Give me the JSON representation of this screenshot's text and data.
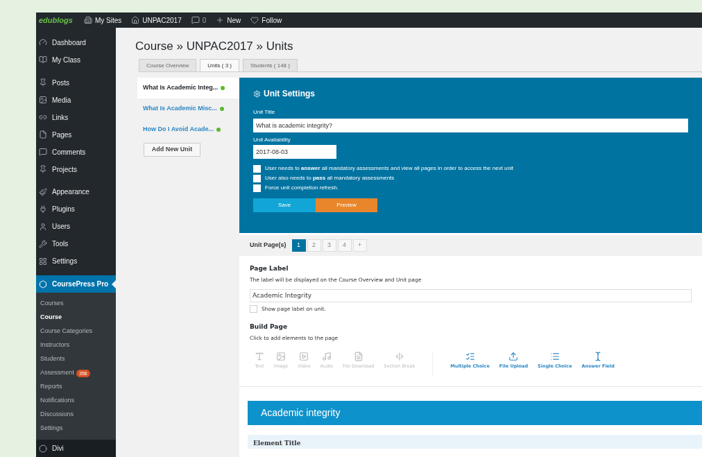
{
  "admin_bar": {
    "logo": "edublogs",
    "items": [
      {
        "kind": "sites",
        "label": "My Sites"
      },
      {
        "kind": "home",
        "label": "UNPAC2017"
      },
      {
        "kind": "comments",
        "label": "0"
      },
      {
        "kind": "new",
        "label": "New"
      },
      {
        "kind": "follow",
        "label": "Follow"
      }
    ]
  },
  "sidebar": {
    "items": [
      {
        "label": "Dashboard",
        "selected": false,
        "gap": false
      },
      {
        "label": "My Class",
        "selected": false,
        "gap": false
      },
      {
        "label": "Posts",
        "selected": false,
        "gap": true
      },
      {
        "label": "Media",
        "selected": false,
        "gap": false
      },
      {
        "label": "Links",
        "selected": false,
        "gap": false
      },
      {
        "label": "Pages",
        "selected": false,
        "gap": false
      },
      {
        "label": "Comments",
        "selected": false,
        "gap": false
      },
      {
        "label": "Projects",
        "selected": false,
        "gap": false
      },
      {
        "label": "Appearance",
        "selected": false,
        "gap": true
      },
      {
        "label": "Plugins",
        "selected": false,
        "gap": false
      },
      {
        "label": "Users",
        "selected": false,
        "gap": false
      },
      {
        "label": "Tools",
        "selected": false,
        "gap": false
      },
      {
        "label": "Settings",
        "selected": false,
        "gap": false
      },
      {
        "label": "CoursePress Pro",
        "selected": true,
        "gap": true,
        "children": [
          {
            "label": "Courses",
            "selected": false
          },
          {
            "label": "Course",
            "selected": true
          },
          {
            "label": "Course Categories",
            "selected": false
          },
          {
            "label": "Instructors",
            "selected": false
          },
          {
            "label": "Students",
            "selected": false
          },
          {
            "label": "Assessment",
            "selected": false,
            "badge": "358"
          },
          {
            "label": "Reports",
            "selected": false
          },
          {
            "label": "Notifications",
            "selected": false
          },
          {
            "label": "Discussions",
            "selected": false
          },
          {
            "label": "Settings",
            "selected": false
          }
        ]
      },
      {
        "label": "Divi",
        "selected": false,
        "gap": false
      }
    ]
  },
  "page_title": "Course » UNPAC2017 » Units",
  "tabs": [
    {
      "label": "Course Overview",
      "selected": false
    },
    {
      "label": "Units ( 3 )",
      "selected": true
    },
    {
      "label": "Students ( 148 )",
      "selected": false
    }
  ],
  "units": [
    {
      "title": "What Is Academic Integ...",
      "selected": true,
      "color": "#5cb82e"
    },
    {
      "title": "What Is Academic Misc...",
      "selected": false,
      "color": "#5cb82e"
    },
    {
      "title": "How Do I Avoid Acade...",
      "selected": false,
      "color": "#5cb82e"
    }
  ],
  "add_unit_button": "Add New Unit",
  "unit_settings": {
    "heading": "Unit Settings",
    "title_label": "Unit Title",
    "title_value": "What is academic integrity?",
    "availability_label": "Unit Availability",
    "availability_value": "2017-08-03",
    "options": [
      {
        "label": "User needs to **answer** all mandatory assessments and view all pages in order to access the next unit",
        "checked": false
      },
      {
        "label": "User also needs to **pass** all mandatory assessments",
        "checked": false
      },
      {
        "label": "Force unit completion refresh.",
        "checked": false
      }
    ],
    "save_button": "Save",
    "preview_button": "Preview"
  },
  "unit_pages": {
    "label": "Unit Page(s)",
    "pages": [
      {
        "label": "1",
        "selected": true
      },
      {
        "label": "2",
        "selected": false
      },
      {
        "label": "3",
        "selected": false
      },
      {
        "label": "4",
        "selected": false
      },
      {
        "label": "+",
        "selected": false
      }
    ]
  },
  "page_label": {
    "heading": "Page Label",
    "hint": "The label will be displayed on the Course Overview and Unit page",
    "value": "Academic Integrity",
    "show_label": {
      "label": "Show page label on unit.",
      "checked": false
    }
  },
  "build_page": {
    "heading": "Build Page",
    "hint": "Click to add elements to the page",
    "elements": [
      {
        "kind": "basic",
        "label": "Text"
      },
      {
        "kind": "basic",
        "label": "Image"
      },
      {
        "kind": "basic",
        "label": "Video"
      },
      {
        "kind": "basic",
        "label": "Audio"
      },
      {
        "kind": "basic",
        "label": "File Download"
      },
      {
        "kind": "basic",
        "label": "Section Break"
      },
      {
        "kind": "question",
        "label": "Multiple Choice"
      },
      {
        "kind": "question",
        "label": "File Upload"
      },
      {
        "kind": "question",
        "label": "Single Choice"
      },
      {
        "kind": "question",
        "label": "Answer Field"
      }
    ]
  },
  "section": {
    "title": "Academic integrity",
    "element_title": "Element Title"
  }
}
